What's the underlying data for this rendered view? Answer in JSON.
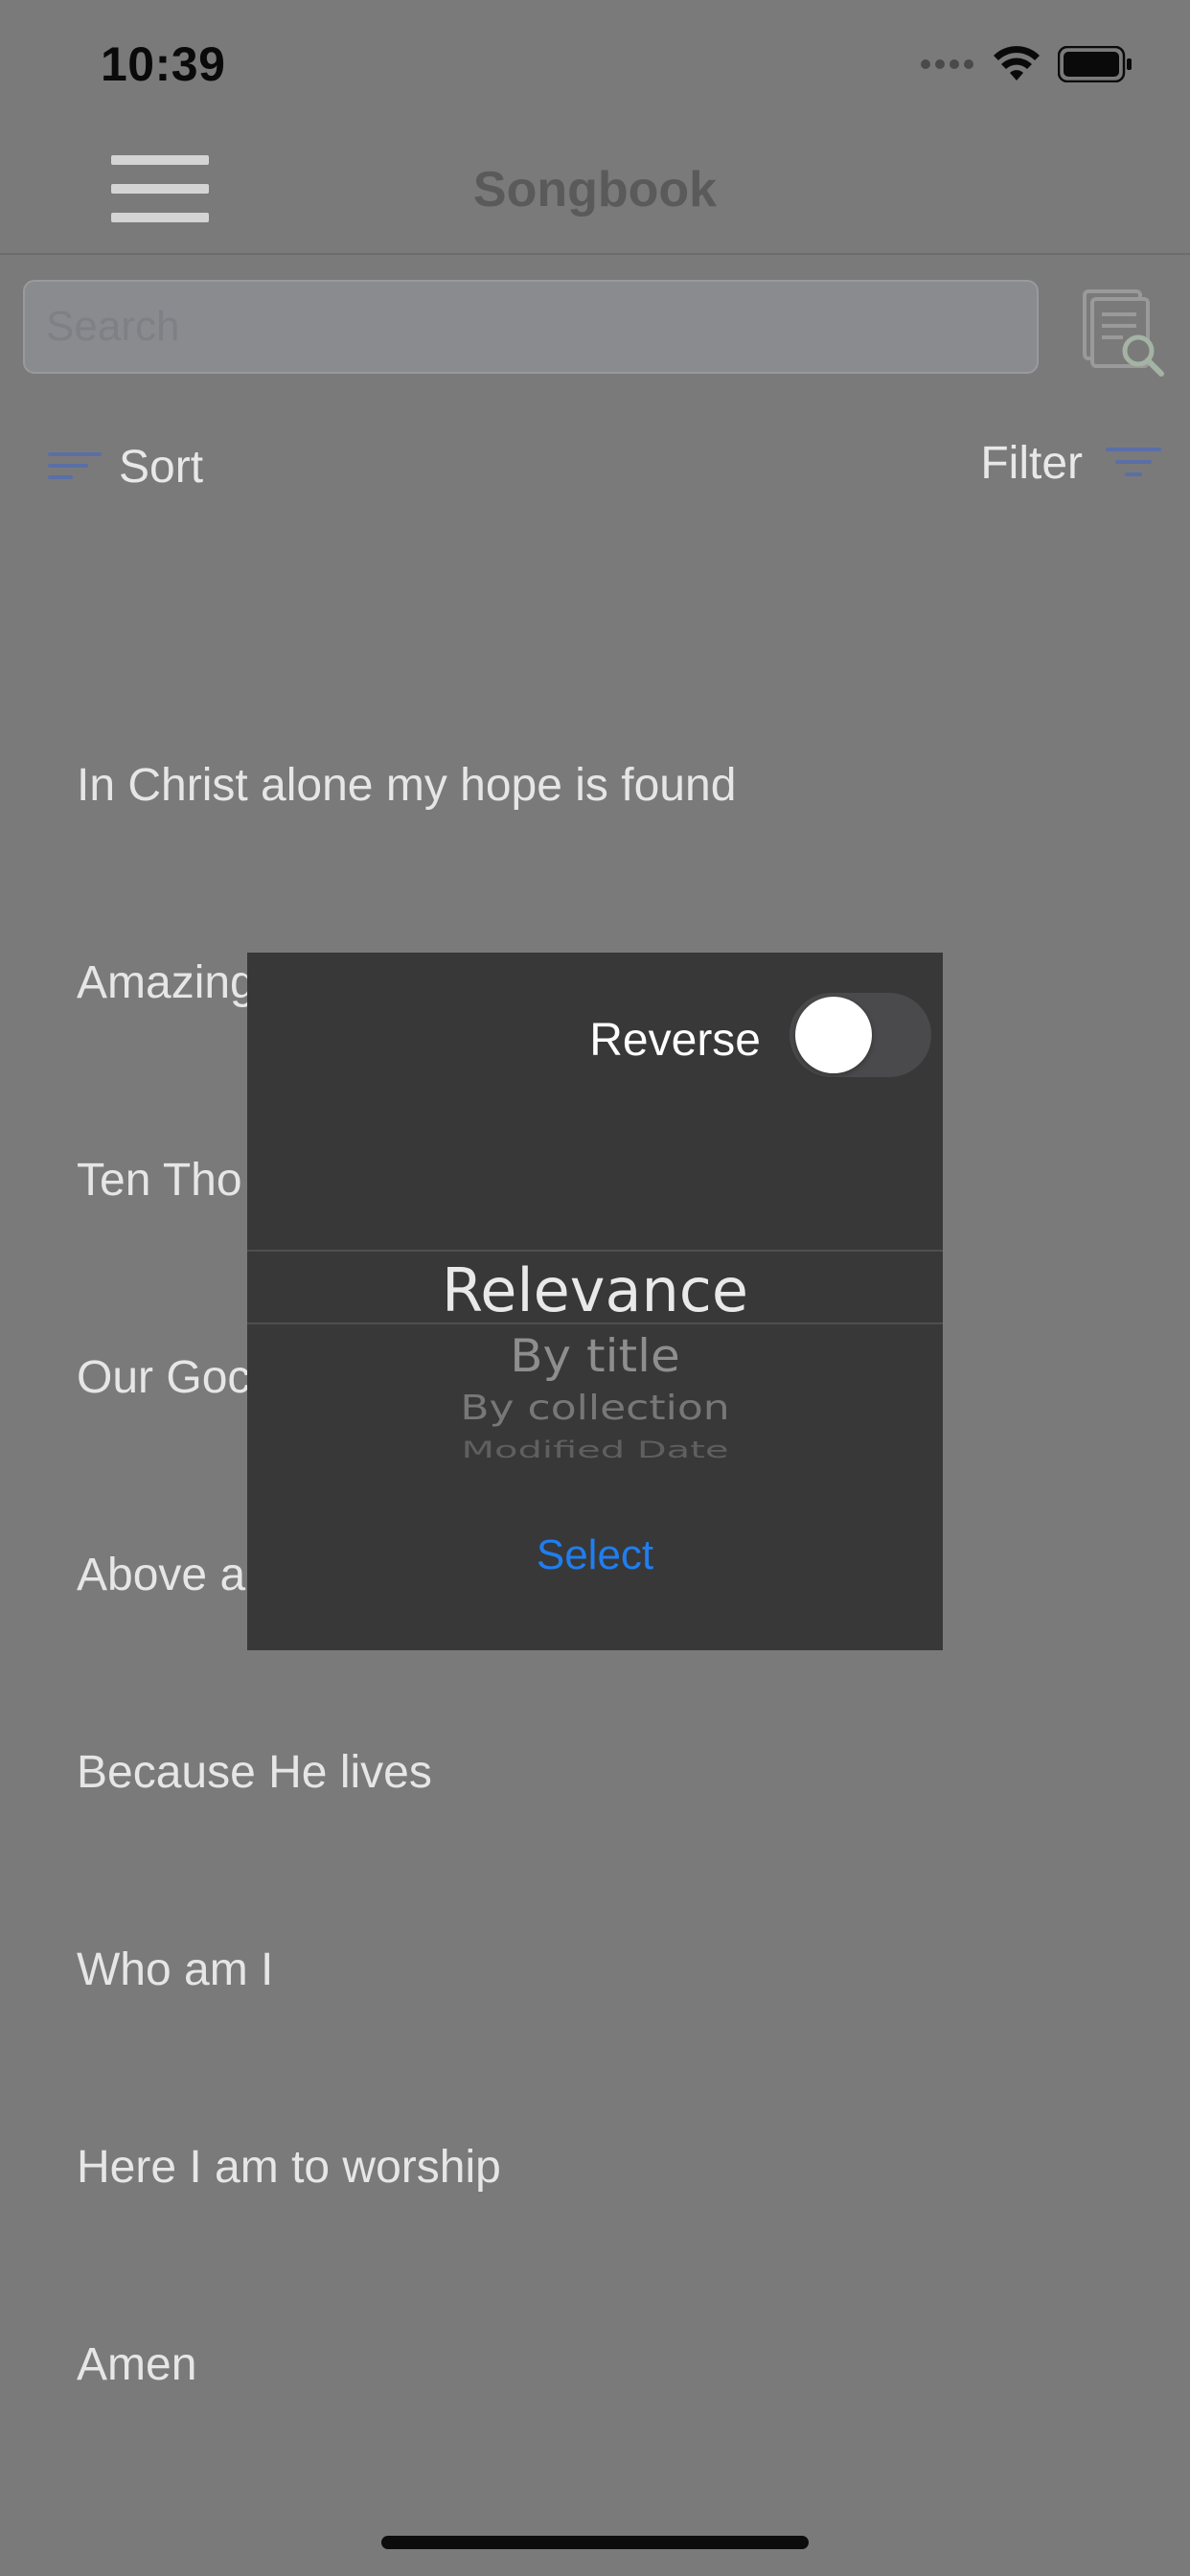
{
  "status_bar": {
    "time": "10:39",
    "icons": [
      "signal-dots-icon",
      "wifi-icon",
      "battery-icon"
    ]
  },
  "header": {
    "title": "Songbook",
    "menu_icon": "hamburger-menu-icon"
  },
  "search": {
    "placeholder": "Search",
    "value": "",
    "action_icon": "document-search-icon"
  },
  "toolbar": {
    "sort_label": "Sort",
    "filter_label": "Filter",
    "accent_color": "#5a6fa8"
  },
  "songs": [
    "In Christ alone my hope is found",
    "Amazing",
    "Ten Tho",
    "Our Goc",
    "Above a",
    "Because He lives",
    "Who am I",
    "Here I am to worship",
    "Amen"
  ],
  "sort_dialog": {
    "reverse_label": "Reverse",
    "reverse_on": false,
    "options": [
      "Relevance",
      "By title",
      "By collection",
      "Modified Date"
    ],
    "selected_index": 0,
    "select_label": "Select",
    "select_color": "#1f7ef0"
  }
}
